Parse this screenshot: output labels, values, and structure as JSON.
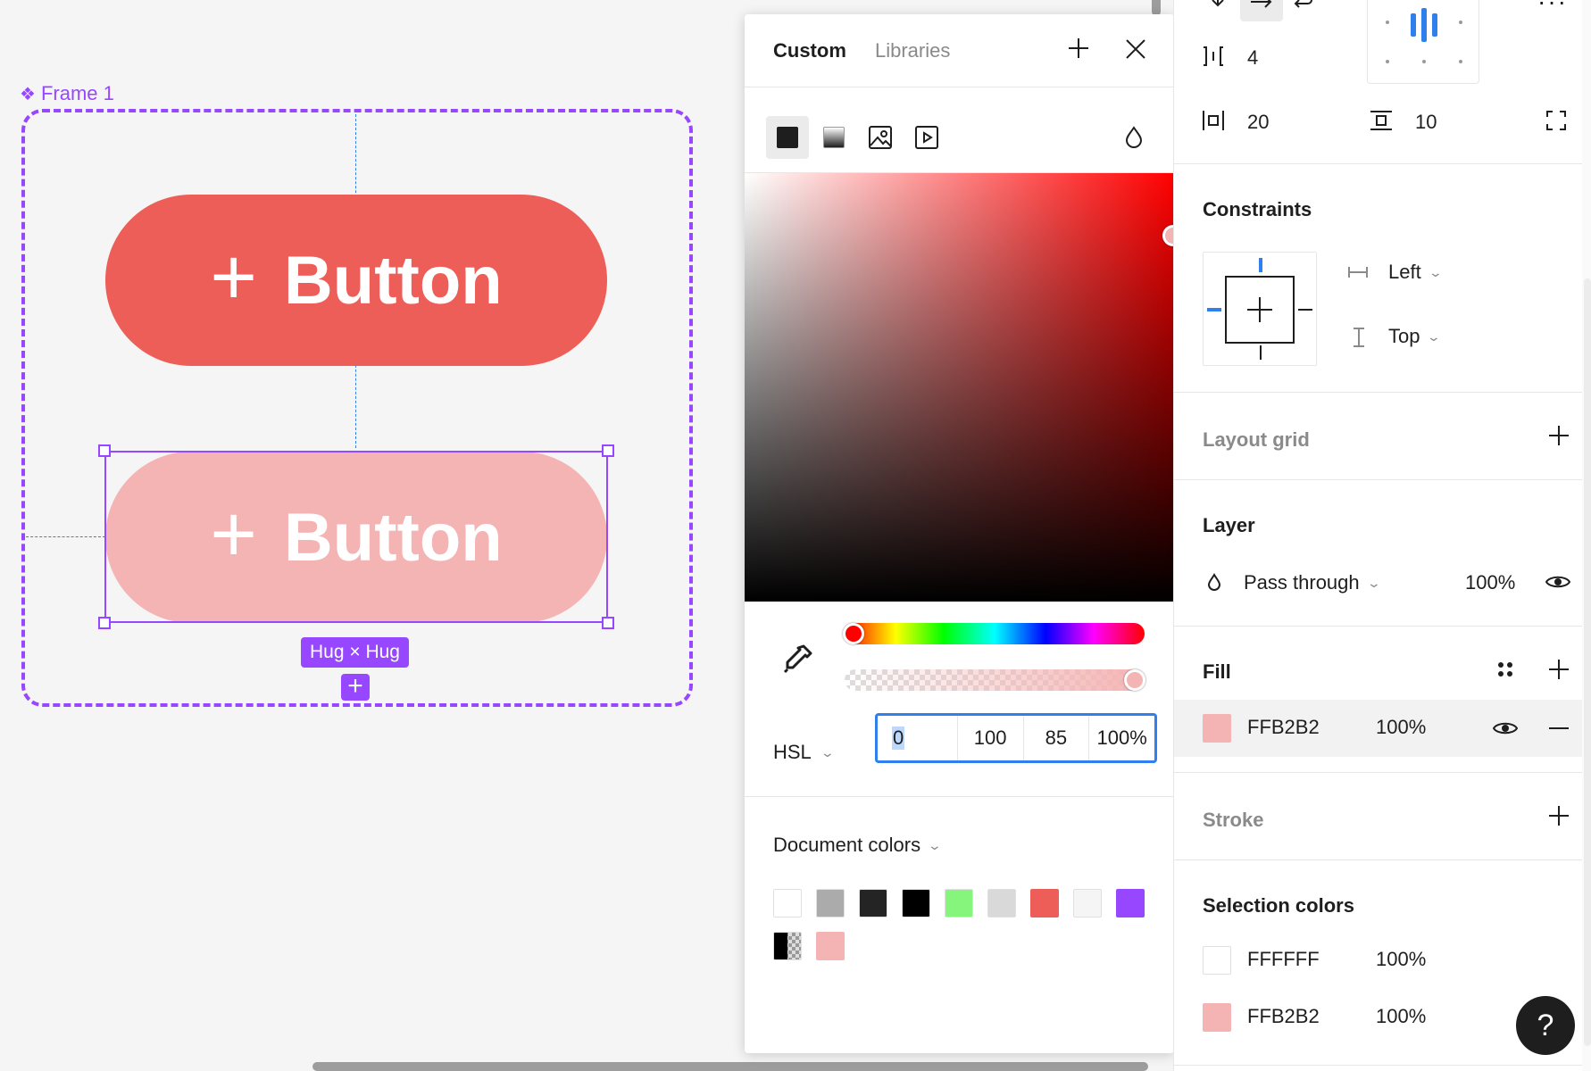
{
  "canvas": {
    "frame_label": "Frame 1",
    "button_top": {
      "label": "Button",
      "icon": "plus-icon",
      "color": "#EE5E58"
    },
    "button_bottom": {
      "label": "Button",
      "icon": "plus-icon",
      "color": "#F5B4B4"
    },
    "size_badge": "Hug × Hug",
    "accent": "#9747FF"
  },
  "picker": {
    "tabs": [
      "Custom",
      "Libraries"
    ],
    "active_tab": "Custom",
    "fill_types": [
      "solid-icon",
      "gradient-icon",
      "image-icon",
      "video-icon"
    ],
    "color_mode": "HSL",
    "fields": {
      "h": "0",
      "s": "100",
      "l": "85",
      "a": "100%"
    },
    "hue_position": 0,
    "alpha_position": 1.0,
    "document_colors_label": "Document colors",
    "document_colors": [
      "#FFFFFF",
      "#ABABAB",
      "#242424",
      "#000000",
      "#85F57B",
      "#D9D9D9",
      "#EE5E58",
      "#F5F5F5",
      "#9747FF",
      "mixed",
      "#F5B4B4"
    ]
  },
  "panel": {
    "auto_layout": {
      "gap": "4",
      "padding_h": "20",
      "padding_v": "10"
    },
    "constraints": {
      "title": "Constraints",
      "horizontal": "Left",
      "vertical": "Top"
    },
    "layout_grid": {
      "title": "Layout grid"
    },
    "layer": {
      "title": "Layer",
      "blend": "Pass through",
      "opacity": "100%"
    },
    "fill": {
      "title": "Fill",
      "hex": "FFB2B2",
      "opacity": "100%",
      "swatch": "#F5B4B4"
    },
    "stroke": {
      "title": "Stroke"
    },
    "selection_colors": {
      "title": "Selection colors",
      "items": [
        {
          "hex": "FFFFFF",
          "opacity": "100%",
          "swatch": "#FFFFFF"
        },
        {
          "hex": "FFB2B2",
          "opacity": "100%",
          "swatch": "#F5B4B4"
        }
      ]
    },
    "help": "?"
  }
}
